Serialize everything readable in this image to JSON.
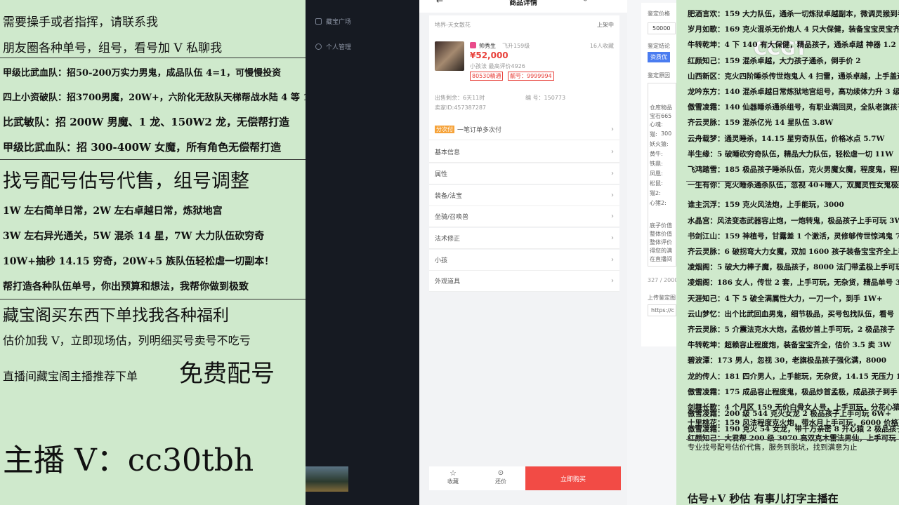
{
  "left": {
    "lines": [
      "需要操手或者指挥，请联系我",
      "朋友圈各种单号，组号，看号加 V 私聊我",
      "甲级比武血队：招50-200万实力男鬼，成品队伍 4=1，可慢慢投资",
      "四上小资破队：招3700男魔，20W+，六阶化无敌队天梯帮战水陆 4 等 1",
      "比武敏队：招 200W 男魔、1 龙、150W2 龙，无偿帮打造",
      "甲级比武血队：招 300-400W 女魔，所有角色无偿帮打造",
      "找号配号估号代售，组号调整",
      "1W 左右简单日常，2W 左右卓越日常，炼狱地宫",
      "3W 左右异光通关，5W 混杀 14 星，7W 大力队伍砍穷奇",
      "10W+抽秒 14.15 穷奇，20W+5 族队伍轻松虐一切副本！",
      "帮打造各种队伍单号，你出预算和想法，我帮你做到极致",
      "藏宝阁买东西下单找我各种福利",
      "估价加我 V，立即现场估，列明细买号卖号不吃亏",
      "直播间藏宝阁主播推荐下单",
      "免费配号",
      "主播 V：cc30tbh"
    ]
  },
  "sidebar": {
    "items": [
      "藏宝广场",
      "个人管理"
    ]
  },
  "app": {
    "title": "商品详情",
    "location": "地界-天女散花",
    "status": "上架中",
    "seller_name": "帅秀生",
    "level": "飞升159级",
    "favorites": "16人收藏",
    "price": "¥52,000",
    "sub_info": "小孩法 最高评价4926",
    "tag1": "80530精通",
    "tag2": "靓号：9999994",
    "time_left": "出售剩余：6天11时",
    "id_label": "编 号：150773",
    "seller_id": "卖家ID:457387287",
    "pay_tag": "分次付",
    "pay_text": "一笔订单多次付",
    "rows": [
      "基本信息",
      "属性",
      "装备/法宝",
      "坐骑/召唤兽",
      "法术修正",
      "小孩",
      "外观道具"
    ],
    "bottom": {
      "fav": "收藏",
      "bargain": "还价",
      "buy": "立即购买"
    }
  },
  "form": {
    "items": [
      "鉴定价格",
      "50000",
      "鉴定结论",
      "资质优",
      "鉴定原因",
      "仓库物品",
      "宝石665",
      "心魂:",
      "猫:",
      "300",
      "妖火猿:",
      "黄牛:",
      "铁鼎:",
      "凤凰:",
      "松鼠:",
      "猫2:",
      "心猪2:",
      "底子价值",
      "整体价值",
      "整体评价",
      "得您的满",
      "在直播间",
      "327 / 2000",
      "上传鉴定图",
      "https://c"
    ]
  },
  "right": {
    "watermark": "CCGT",
    "lines": [
      "肥酒言欢：159 大力队伍，通杀一切炼狱卓越副本，微调灵猴到手",
      "岁月如歌：169 克火混杀无价炮人 4 只大保健，装备宝宝灵宝齐全",
      "牛转乾坤：4 下 140 有大保健，精品孩子，通杀卓越 神器 1.2",
      "红颜知己：159 混杀卓越，大力孩子通杀，倒手价 2",
      "山西新区：克火四阶睡杀传世炮鬼人 4 扫雷，通杀卓越，上手盖过",
      "龙吟东方：140 混杀卓越日常炼狱地宫组号，高功续体力升 3 级+",
      "傲雪凌霜：140 仙器睡杀通杀组号，有职业满回灵，全队老旗孩子",
      "齐云灵脉：159 混杀亿光 14 星队伍 3.8W",
      "云舟载梦：通灵睡杀，14.15 星穷奇队伍，价格冰点 5.7W",
      "半生缘：5 破睡砍穷奇队伍，精品大力队伍，轻松虐一切 11W",
      "飞鸿踏雪：185 极品孩子睡杀队伍，克火男魔女魔，程度鬼，程度",
      "一生有你：克火睡杀通杀队伍，忽视 40+睡人，双魔灵性女鬼极致",
      "谁主沉浮：159 克火风法炮，上手能玩，3000",
      "水晶宫：风法变态武器容止炮，一炮转鬼，极品孩子上手可玩 3W",
      "书剑江山：159 神植号，甘露差 1 个激活，灵修够传世惊鸿鬼 7 满",
      "齐云灵脉：6 破拐弯大力女魔，双加 1600 孩子装备宝宝齐全上手",
      "凌烟阁：5 破大力棒子魔，极品孩子，8000 法门带孟极上手可玩",
      "凌烟阁：186 女人，传世 2 套，上手可玩，无杂货，精品单号 3.8",
      "天涯知己：4 下 5 破全满属性大力，一刀一个，到手 1W+",
      "云山梦忆：出个比武回血男鬼，细节极品，买号包找队伍，看号",
      "齐云灵脉：5 介震法克水大炮，孟极炒首上手可玩，2 极品孩子",
      "牛转乾坤：超赖容止程度炮，装备宝宝齐全，估价 3.5 卖 3W",
      "碧波潭：173 男人，忽视 30，老旗极品孩子强化满，8000",
      "龙的传人：181 四介男人，上手能玩，无杂货，14.15 无压力 1.8W",
      "傲雪凌霜：175 成品容止程度鬼，极品炒首孟极，成品孩子到手",
      "剑舞长歌：4 个月区 159 无价白骨女人号，上手可玩，分花心猿整",
      "十里桃花：159 风法程度克火炮，带水月上手可玩，6000 价格可谈",
      "红颜知己：大君帮 200 级 3070 高双克木雷法男仙，上手可玩 10W",
      "傲雪凌霜：200 级 544 克火女龙 2 极品孩子上手可玩 6W+",
      "傲雪凌霜：190 克火 54 女龙，带千万亲密 8 开心猿 2 极品孩子 9W",
      "专业找号配号估价代售，服务到脱坑，找到满意为止"
    ],
    "footer": "估号+V 秒估    有事儿打字主播在"
  }
}
